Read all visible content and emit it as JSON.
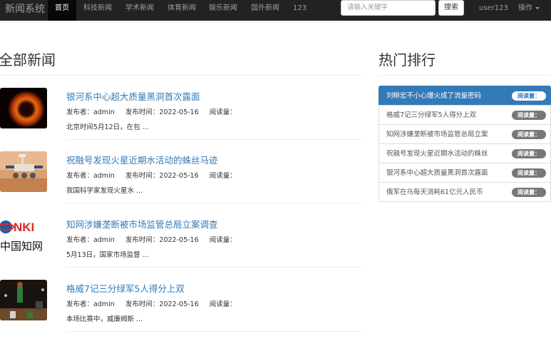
{
  "navbar": {
    "brand": "新闻系统",
    "items": [
      {
        "label": "首页",
        "active": true
      },
      {
        "label": "科技新闻"
      },
      {
        "label": "学术新闻"
      },
      {
        "label": "体育新闻"
      },
      {
        "label": "娱乐新闻"
      },
      {
        "label": "国外新闻"
      },
      {
        "label": "123"
      }
    ],
    "search_placeholder": "请输入关键字",
    "search_button": "搜索",
    "user": "user123",
    "ops": "操作"
  },
  "main": {
    "title": "全部新闻",
    "news": [
      {
        "title": "银河系中心超大质量黑洞首次露面",
        "author_label": "发布者：",
        "author": "admin",
        "time_label": "发布时间：",
        "time": "2022-05-16",
        "reads_label": "阅读量：",
        "excerpt": "北京时间5月12日，在包 ...",
        "thumb": "black-hole-image"
      },
      {
        "title": "祝融号发现火星近期水活动的蛛丝马迹",
        "author_label": "发布者：",
        "author": "admin",
        "time_label": "发布时间：",
        "time": "2022-05-16",
        "reads_label": "阅读量：",
        "excerpt": "我国科学家发现火星水 ...",
        "thumb": "mars-rover-image"
      },
      {
        "title": "知网涉嫌垄断被市场监管总局立案调查",
        "author_label": "发布者：",
        "author": "admin",
        "time_label": "发布时间：",
        "time": "2022-05-16",
        "reads_label": "阅读量：",
        "excerpt": "5月13日，国家市场监督 ...",
        "thumb": "cnki-logo",
        "logo_text": "NKI",
        "logo_sub": "中国知网"
      },
      {
        "title": "格威7记三分绿军5人得分上双",
        "author_label": "发布者：",
        "author": "admin",
        "time_label": "发布时间：",
        "time": "2022-05-16",
        "reads_label": "阅读量：",
        "excerpt": "本场比赛中，威廉姆斯 ...",
        "thumb": "basketball-image"
      }
    ]
  },
  "hot": {
    "title": "热门排行",
    "items": [
      {
        "label": "刘畊宏不小心爆火成了流量密码",
        "badge": "阅读量："
      },
      {
        "label": "格威7记三分绿军5人得分上双",
        "badge": "阅读量："
      },
      {
        "label": "知网涉嫌垄断被市场监管总局立案",
        "badge": "阅读量："
      },
      {
        "label": "祝融号发现火星近期水活动的蛛丝",
        "badge": "阅读量："
      },
      {
        "label": "银河系中心超大质量黑洞首次露面",
        "badge": "阅读量："
      },
      {
        "label": "俄军在乌每天消耗61亿元人民币",
        "badge": "阅读量："
      }
    ]
  },
  "colors": {
    "navbar": "#222222",
    "link": "#337ab7",
    "badge": "#777777"
  }
}
